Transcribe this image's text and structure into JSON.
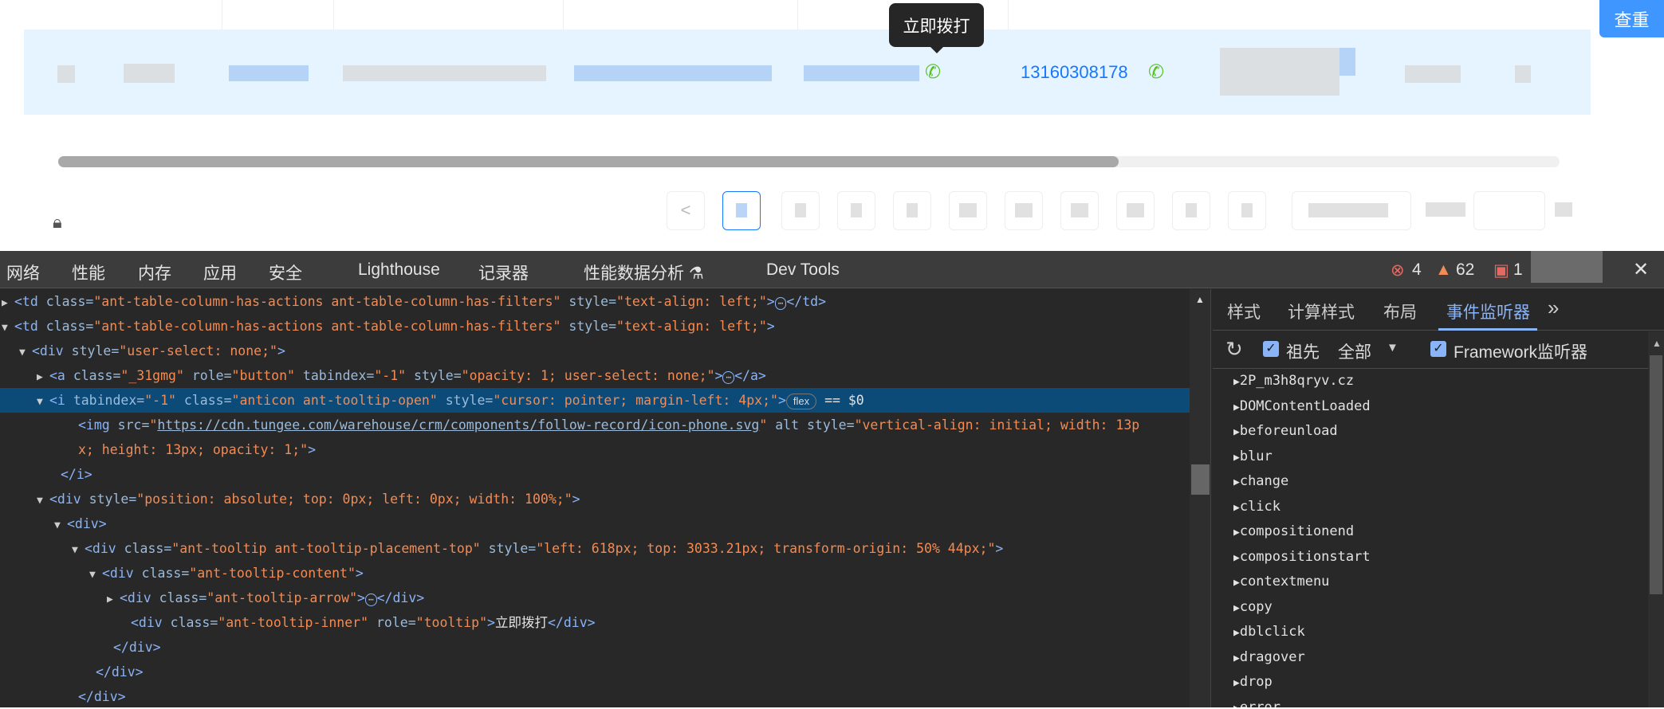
{
  "page": {
    "tooltip": "立即拨打",
    "phone_number": "13160308178",
    "dedupe_button": "查重",
    "pagination_prev": "<"
  },
  "devtools": {
    "tabs": [
      "网络",
      "性能",
      "内存",
      "应用",
      "安全",
      "Lighthouse",
      "记录器",
      "性能数据分析 ⚗",
      "Dev Tools"
    ],
    "status": {
      "errors": "4",
      "warnings": "62",
      "issues": "1"
    },
    "close": "✕",
    "dom_lines": [
      {
        "indent": 0,
        "tri": "▶",
        "html": [
          [
            "tg",
            "<td "
          ],
          [
            "at",
            "class="
          ],
          [
            "av",
            "\"ant-table-column-has-actions ant-table-column-has-filters\""
          ],
          [
            "at",
            " style="
          ],
          [
            "av",
            "\"text-align: left;\""
          ],
          [
            "tg",
            ">"
          ],
          [
            "dots",
            "⋯"
          ],
          [
            "tg",
            "</td>"
          ]
        ]
      },
      {
        "indent": 0,
        "tri": "▼",
        "html": [
          [
            "tg",
            "<td "
          ],
          [
            "at",
            "class="
          ],
          [
            "av",
            "\"ant-table-column-has-actions ant-table-column-has-filters\""
          ],
          [
            "at",
            " style="
          ],
          [
            "av",
            "\"text-align: left;\""
          ],
          [
            "tg",
            ">"
          ]
        ]
      },
      {
        "indent": 1,
        "tri": "▼",
        "html": [
          [
            "tg",
            "<div "
          ],
          [
            "at",
            "style="
          ],
          [
            "av",
            "\"user-select: none;\""
          ],
          [
            "tg",
            ">"
          ]
        ]
      },
      {
        "indent": 2,
        "tri": "▶",
        "html": [
          [
            "tg",
            "<a "
          ],
          [
            "at",
            "class="
          ],
          [
            "av",
            "\"_31gmg\""
          ],
          [
            "at",
            " role="
          ],
          [
            "av",
            "\"button\""
          ],
          [
            "at",
            " tabindex="
          ],
          [
            "av",
            "\"-1\""
          ],
          [
            "at",
            " style="
          ],
          [
            "av",
            "\"opacity: 1; user-select: none;\""
          ],
          [
            "tg",
            ">"
          ],
          [
            "dots",
            "⋯"
          ],
          [
            "tg",
            "</a>"
          ]
        ]
      },
      {
        "indent": 2,
        "tri": "▼",
        "selected": true,
        "html": [
          [
            "tg",
            "<i "
          ],
          [
            "at",
            "tabindex="
          ],
          [
            "av",
            "\"-1\""
          ],
          [
            "at",
            " class="
          ],
          [
            "av",
            "\"anticon ant-tooltip-open\""
          ],
          [
            "at",
            " style="
          ],
          [
            "av",
            "\"cursor: pointer; margin-left: 4px;\""
          ],
          [
            "tg",
            ">"
          ],
          [
            "badge",
            "flex"
          ],
          [
            "tx",
            " == $0"
          ]
        ]
      },
      {
        "indent": 3,
        "tri": "",
        "html": [
          [
            "tg",
            "<img "
          ],
          [
            "at",
            "src="
          ],
          [
            "av",
            "\"https://cdn.tungee.com/warehouse/crm/components/follow-record/icon-phone.svg\""
          ],
          [
            "at",
            " alt style="
          ],
          [
            "av",
            "\"vertical-align: initial; width: 13p"
          ]
        ]
      },
      {
        "indent": 3,
        "tri": "",
        "html": [
          [
            "av",
            "x; height: 13px; opacity: 1;\""
          ],
          [
            "tg",
            ">"
          ]
        ]
      },
      {
        "indent": 2,
        "tri": "",
        "html": [
          [
            "tg",
            "</i>"
          ]
        ]
      },
      {
        "indent": 2,
        "tri": "▼",
        "html": [
          [
            "tg",
            "<div "
          ],
          [
            "at",
            "style="
          ],
          [
            "av",
            "\"position: absolute; top: 0px; left: 0px; width: 100%;\""
          ],
          [
            "tg",
            ">"
          ]
        ]
      },
      {
        "indent": 3,
        "tri": "▼",
        "html": [
          [
            "tg",
            "<div>"
          ]
        ]
      },
      {
        "indent": 4,
        "tri": "▼",
        "html": [
          [
            "tg",
            "<div "
          ],
          [
            "at",
            "class="
          ],
          [
            "av",
            "\"ant-tooltip ant-tooltip-placement-top\""
          ],
          [
            "at",
            " style="
          ],
          [
            "av",
            "\"left: 618px; top: 3033.21px; transform-origin: 50% 44px;\""
          ],
          [
            "tg",
            ">"
          ]
        ]
      },
      {
        "indent": 5,
        "tri": "▼",
        "html": [
          [
            "tg",
            "<div "
          ],
          [
            "at",
            "class="
          ],
          [
            "av",
            "\"ant-tooltip-content\""
          ],
          [
            "tg",
            ">"
          ]
        ]
      },
      {
        "indent": 6,
        "tri": "▶",
        "html": [
          [
            "tg",
            "<div "
          ],
          [
            "at",
            "class="
          ],
          [
            "av",
            "\"ant-tooltip-arrow\""
          ],
          [
            "tg",
            ">"
          ],
          [
            "dots",
            "⋯"
          ],
          [
            "tg",
            "</div>"
          ]
        ]
      },
      {
        "indent": 6,
        "tri": "",
        "html": [
          [
            "tg",
            "<div "
          ],
          [
            "at",
            "class="
          ],
          [
            "av",
            "\"ant-tooltip-inner\""
          ],
          [
            "at",
            " role="
          ],
          [
            "av",
            "\"tooltip\""
          ],
          [
            "tg",
            ">"
          ],
          [
            "tx",
            "立即拨打"
          ],
          [
            "tg",
            "</div>"
          ]
        ]
      },
      {
        "indent": 5,
        "tri": "",
        "html": [
          [
            "tg",
            "</div>"
          ]
        ]
      },
      {
        "indent": 4,
        "tri": "",
        "html": [
          [
            "tg",
            "</div>"
          ]
        ]
      },
      {
        "indent": 3,
        "tri": "",
        "html": [
          [
            "tg",
            "</div>"
          ]
        ]
      }
    ],
    "side_tabs": [
      "样式",
      "计算样式",
      "布局",
      "事件监听器",
      "»"
    ],
    "toolbar": {
      "ancestors": "祖先",
      "filter": "全部",
      "framework": "Framework监听器"
    },
    "events": [
      "2P_m3h8qryv.cz",
      "DOMContentLoaded",
      "beforeunload",
      "blur",
      "change",
      "click",
      "compositionend",
      "compositionstart",
      "contextmenu",
      "copy",
      "dblclick",
      "dragover",
      "drop",
      "error"
    ]
  }
}
